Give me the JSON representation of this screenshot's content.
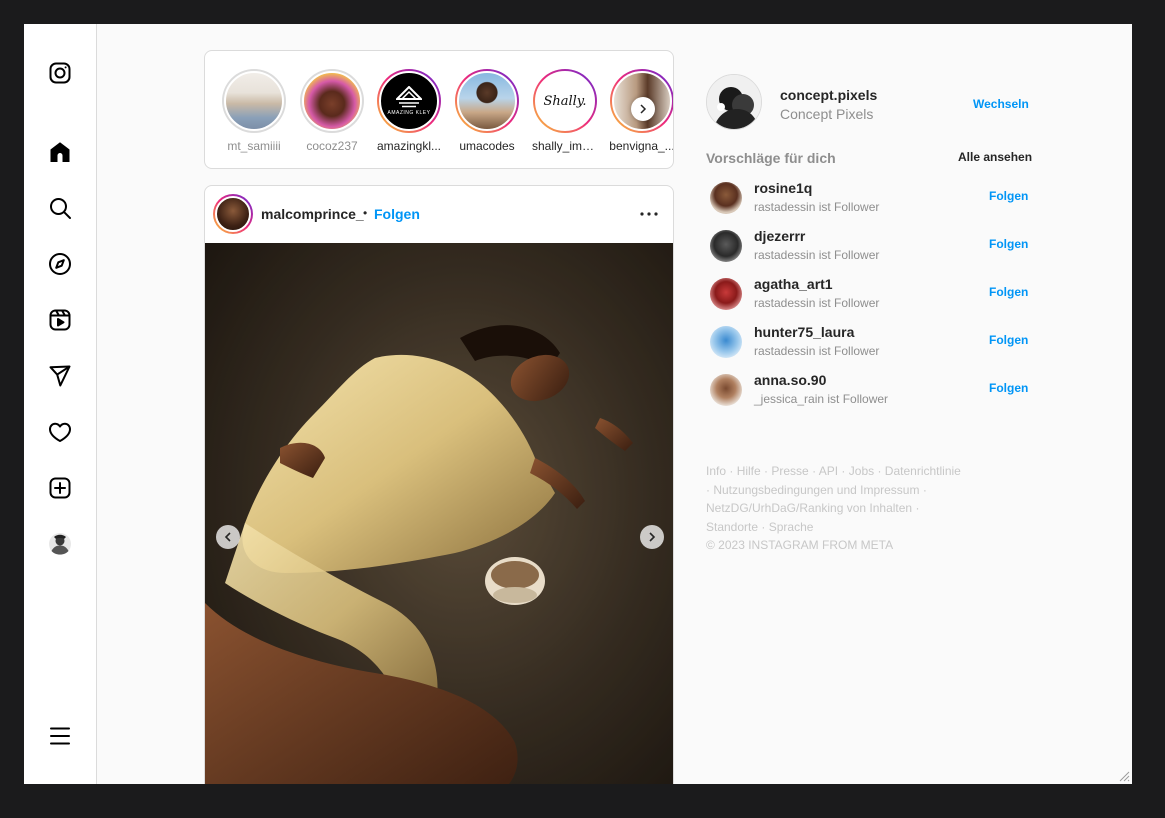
{
  "nav": {
    "items": [
      {
        "icon": "instagram-logo-icon"
      },
      {
        "icon": "home-icon"
      },
      {
        "icon": "search-icon"
      },
      {
        "icon": "explore-icon"
      },
      {
        "icon": "reels-icon"
      },
      {
        "icon": "messages-icon"
      },
      {
        "icon": "notifications-icon"
      },
      {
        "icon": "create-icon"
      },
      {
        "icon": "profile-icon"
      },
      {
        "icon": "menu-icon"
      }
    ]
  },
  "stories": [
    {
      "name": "mt_samiiii",
      "seen": true
    },
    {
      "name": "cocoz237",
      "seen": true
    },
    {
      "name": "amazingkl...",
      "seen": false
    },
    {
      "name": "umacodes",
      "seen": false
    },
    {
      "name": "shally_ima...",
      "seen": false
    },
    {
      "name": "benvigna_...",
      "seen": false
    }
  ],
  "story_logo_text": "AMAZING KLEY",
  "story_script_text": "Shally.",
  "post": {
    "username": "malcomprince_",
    "dot": "•",
    "follow_label": "Folgen"
  },
  "profile": {
    "username": "concept.pixels",
    "full_name": "Concept Pixels",
    "switch_label": "Wechseln"
  },
  "suggestions": {
    "title": "Vorschläge für dich",
    "see_all": "Alle ansehen",
    "items": [
      {
        "username": "rosine1q",
        "subtitle": "rastadessin ist Follower",
        "follow": "Folgen"
      },
      {
        "username": "djezerrr",
        "subtitle": "rastadessin ist Follower",
        "follow": "Folgen"
      },
      {
        "username": "agatha_art1",
        "subtitle": "rastadessin ist Follower",
        "follow": "Folgen"
      },
      {
        "username": "hunter75_laura",
        "subtitle": "rastadessin ist Follower",
        "follow": "Folgen"
      },
      {
        "username": "anna.so.90",
        "subtitle": "_jessica_rain ist Follower",
        "follow": "Folgen"
      }
    ]
  },
  "footer": {
    "links": [
      "Info",
      "Hilfe",
      "Presse",
      "API",
      "Jobs",
      "Datenrichtlinie",
      "Nutzungsbedingungen und Impressum",
      "NetzDG/UrhDaG/Ranking von Inhalten",
      "Standorte",
      "Sprache"
    ],
    "separator": " · ",
    "copyright": "© 2023 INSTAGRAM FROM META"
  },
  "colors": {
    "accent": "#0095f6",
    "text": "#262626",
    "muted": "#8e8e8e",
    "border": "#dbdbdb"
  }
}
